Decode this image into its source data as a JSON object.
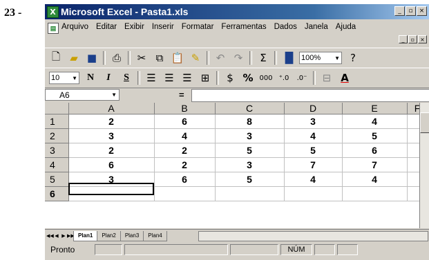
{
  "question_number": "23 -",
  "window": {
    "title": "Microsoft Excel - Pasta1.xls",
    "app_icon": "X"
  },
  "menu": [
    "Arquivo",
    "Editar",
    "Exibir",
    "Inserir",
    "Formatar",
    "Ferramentas",
    "Dados",
    "Janela",
    "Ajuda"
  ],
  "toolbar": {
    "zoom": "100%",
    "font_size": "10",
    "bold": "N",
    "italic": "I",
    "underline": "S",
    "sum": "Σ",
    "percent": "%",
    "thousands": "000"
  },
  "formula_bar": {
    "name_box": "A6",
    "equals": "=",
    "value": ""
  },
  "grid": {
    "columns": [
      "A",
      "B",
      "C",
      "D",
      "E",
      "F"
    ],
    "rows": [
      {
        "num": "1",
        "cells": [
          "2",
          "6",
          "8",
          "3",
          "4"
        ]
      },
      {
        "num": "2",
        "cells": [
          "3",
          "4",
          "3",
          "4",
          "5"
        ]
      },
      {
        "num": "3",
        "cells": [
          "2",
          "2",
          "5",
          "5",
          "6"
        ]
      },
      {
        "num": "4",
        "cells": [
          "6",
          "2",
          "3",
          "7",
          "7"
        ]
      },
      {
        "num": "5",
        "cells": [
          "3",
          "6",
          "5",
          "4",
          "4"
        ]
      },
      {
        "num": "6",
        "cells": [
          "",
          "",
          "",
          "",
          ""
        ]
      }
    ]
  },
  "sheet_tabs": [
    "Plan1",
    "Plan2",
    "Plan3",
    "Plan4"
  ],
  "status": {
    "text": "Pronto",
    "num": "NÚM"
  }
}
